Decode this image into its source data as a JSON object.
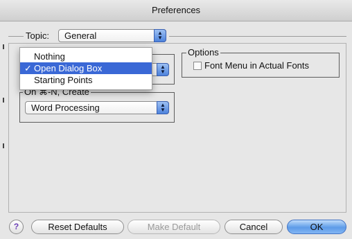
{
  "window": {
    "title": "Preferences"
  },
  "topic": {
    "label": "Topic:",
    "value": "General"
  },
  "menu": {
    "items": [
      {
        "label": "Nothing",
        "checked": false
      },
      {
        "label": "Open Dialog Box",
        "checked": true
      },
      {
        "label": "Starting Points",
        "checked": false
      }
    ],
    "check_glyph": "✓"
  },
  "on_new": {
    "label": "On ⌘-N, Create",
    "value": "Word Processing"
  },
  "options": {
    "label": "Options",
    "checkbox_label": "Font Menu in Actual Fonts",
    "checked": false
  },
  "buttons": {
    "help": "?",
    "reset": "Reset Defaults",
    "make_default": "Make Default",
    "cancel": "Cancel",
    "ok": "OK"
  },
  "colors": {
    "accent": "#3a68d6",
    "default_button": "#5d9be8"
  }
}
